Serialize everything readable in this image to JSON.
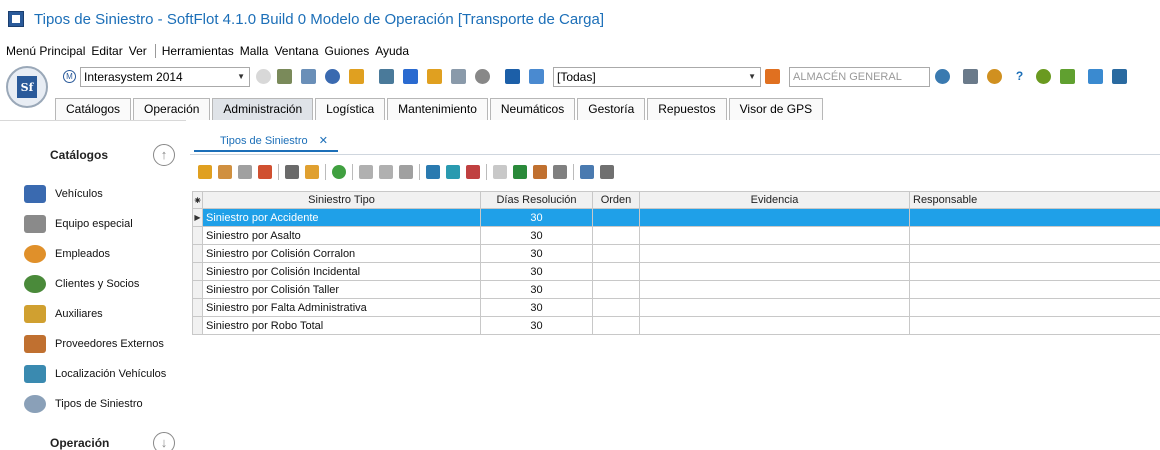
{
  "window": {
    "title": "Tipos de Siniestro - SoftFlot 4.1.0 Build 0  Modelo de Operación [Transporte de Carga]"
  },
  "menu": {
    "items": [
      "Menú Principal",
      "Editar",
      "Ver"
    ],
    "items2": [
      "Herramientas",
      "Malla",
      "Ventana",
      "Guiones",
      "Ayuda"
    ]
  },
  "toolbar": {
    "company": "Interasystem 2014",
    "branch": "[Todas]",
    "warehouse_placeholder": "ALMACÉN GENERAL"
  },
  "main_tabs": [
    "Catálogos",
    "Operación",
    "Administración",
    "Logística",
    "Mantenimiento",
    "Neumáticos",
    "Gestoría",
    "Repuestos",
    "Visor de GPS"
  ],
  "sidebar": {
    "section1": "Catálogos",
    "items": [
      "Vehículos",
      "Equipo especial",
      "Empleados",
      "Clientes y Socios",
      "Auxiliares",
      "Proveedores Externos",
      "Localización Vehículos",
      "Tipos de Siniestro"
    ],
    "section2": "Operación"
  },
  "document_tab": {
    "label": "Tipos de Siniestro",
    "close": "✕"
  },
  "grid": {
    "columns": [
      "Siniestro Tipo",
      "Días Resolución",
      "Orden",
      "Evidencia",
      "Responsable"
    ],
    "rows": [
      {
        "tipo": "Siniestro por Accidente",
        "dias": "30"
      },
      {
        "tipo": "Siniestro por Asalto",
        "dias": "30"
      },
      {
        "tipo": "Siniestro por Colisión Corralon",
        "dias": "30"
      },
      {
        "tipo": "Siniestro por Colisión Incidental",
        "dias": "30"
      },
      {
        "tipo": "Siniestro por Colisión Taller",
        "dias": "30"
      },
      {
        "tipo": "Siniestro por Falta Administrativa",
        "dias": "30"
      },
      {
        "tipo": "Siniestro por Robo Total",
        "dias": "30"
      }
    ]
  },
  "colors": {
    "accent": "#1c6fb8",
    "selection": "#1fa0e8"
  }
}
